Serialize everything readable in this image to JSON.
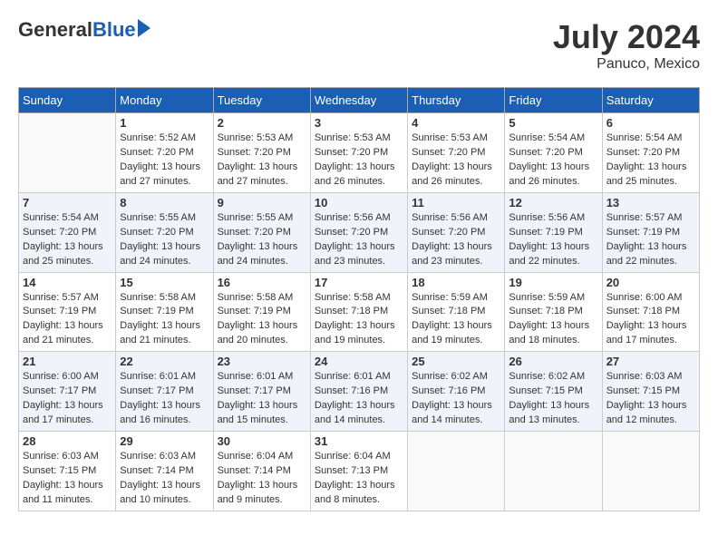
{
  "header": {
    "logo_general": "General",
    "logo_blue": "Blue",
    "month_year": "July 2024",
    "location": "Panuco, Mexico"
  },
  "days_of_week": [
    "Sunday",
    "Monday",
    "Tuesday",
    "Wednesday",
    "Thursday",
    "Friday",
    "Saturday"
  ],
  "weeks": [
    [
      {
        "day": "",
        "info": ""
      },
      {
        "day": "1",
        "info": "Sunrise: 5:52 AM\nSunset: 7:20 PM\nDaylight: 13 hours\nand 27 minutes."
      },
      {
        "day": "2",
        "info": "Sunrise: 5:53 AM\nSunset: 7:20 PM\nDaylight: 13 hours\nand 27 minutes."
      },
      {
        "day": "3",
        "info": "Sunrise: 5:53 AM\nSunset: 7:20 PM\nDaylight: 13 hours\nand 26 minutes."
      },
      {
        "day": "4",
        "info": "Sunrise: 5:53 AM\nSunset: 7:20 PM\nDaylight: 13 hours\nand 26 minutes."
      },
      {
        "day": "5",
        "info": "Sunrise: 5:54 AM\nSunset: 7:20 PM\nDaylight: 13 hours\nand 26 minutes."
      },
      {
        "day": "6",
        "info": "Sunrise: 5:54 AM\nSunset: 7:20 PM\nDaylight: 13 hours\nand 25 minutes."
      }
    ],
    [
      {
        "day": "7",
        "info": "Sunrise: 5:54 AM\nSunset: 7:20 PM\nDaylight: 13 hours\nand 25 minutes."
      },
      {
        "day": "8",
        "info": "Sunrise: 5:55 AM\nSunset: 7:20 PM\nDaylight: 13 hours\nand 24 minutes."
      },
      {
        "day": "9",
        "info": "Sunrise: 5:55 AM\nSunset: 7:20 PM\nDaylight: 13 hours\nand 24 minutes."
      },
      {
        "day": "10",
        "info": "Sunrise: 5:56 AM\nSunset: 7:20 PM\nDaylight: 13 hours\nand 23 minutes."
      },
      {
        "day": "11",
        "info": "Sunrise: 5:56 AM\nSunset: 7:20 PM\nDaylight: 13 hours\nand 23 minutes."
      },
      {
        "day": "12",
        "info": "Sunrise: 5:56 AM\nSunset: 7:19 PM\nDaylight: 13 hours\nand 22 minutes."
      },
      {
        "day": "13",
        "info": "Sunrise: 5:57 AM\nSunset: 7:19 PM\nDaylight: 13 hours\nand 22 minutes."
      }
    ],
    [
      {
        "day": "14",
        "info": "Sunrise: 5:57 AM\nSunset: 7:19 PM\nDaylight: 13 hours\nand 21 minutes."
      },
      {
        "day": "15",
        "info": "Sunrise: 5:58 AM\nSunset: 7:19 PM\nDaylight: 13 hours\nand 21 minutes."
      },
      {
        "day": "16",
        "info": "Sunrise: 5:58 AM\nSunset: 7:19 PM\nDaylight: 13 hours\nand 20 minutes."
      },
      {
        "day": "17",
        "info": "Sunrise: 5:58 AM\nSunset: 7:18 PM\nDaylight: 13 hours\nand 19 minutes."
      },
      {
        "day": "18",
        "info": "Sunrise: 5:59 AM\nSunset: 7:18 PM\nDaylight: 13 hours\nand 19 minutes."
      },
      {
        "day": "19",
        "info": "Sunrise: 5:59 AM\nSunset: 7:18 PM\nDaylight: 13 hours\nand 18 minutes."
      },
      {
        "day": "20",
        "info": "Sunrise: 6:00 AM\nSunset: 7:18 PM\nDaylight: 13 hours\nand 17 minutes."
      }
    ],
    [
      {
        "day": "21",
        "info": "Sunrise: 6:00 AM\nSunset: 7:17 PM\nDaylight: 13 hours\nand 17 minutes."
      },
      {
        "day": "22",
        "info": "Sunrise: 6:01 AM\nSunset: 7:17 PM\nDaylight: 13 hours\nand 16 minutes."
      },
      {
        "day": "23",
        "info": "Sunrise: 6:01 AM\nSunset: 7:17 PM\nDaylight: 13 hours\nand 15 minutes."
      },
      {
        "day": "24",
        "info": "Sunrise: 6:01 AM\nSunset: 7:16 PM\nDaylight: 13 hours\nand 14 minutes."
      },
      {
        "day": "25",
        "info": "Sunrise: 6:02 AM\nSunset: 7:16 PM\nDaylight: 13 hours\nand 14 minutes."
      },
      {
        "day": "26",
        "info": "Sunrise: 6:02 AM\nSunset: 7:15 PM\nDaylight: 13 hours\nand 13 minutes."
      },
      {
        "day": "27",
        "info": "Sunrise: 6:03 AM\nSunset: 7:15 PM\nDaylight: 13 hours\nand 12 minutes."
      }
    ],
    [
      {
        "day": "28",
        "info": "Sunrise: 6:03 AM\nSunset: 7:15 PM\nDaylight: 13 hours\nand 11 minutes."
      },
      {
        "day": "29",
        "info": "Sunrise: 6:03 AM\nSunset: 7:14 PM\nDaylight: 13 hours\nand 10 minutes."
      },
      {
        "day": "30",
        "info": "Sunrise: 6:04 AM\nSunset: 7:14 PM\nDaylight: 13 hours\nand 9 minutes."
      },
      {
        "day": "31",
        "info": "Sunrise: 6:04 AM\nSunset: 7:13 PM\nDaylight: 13 hours\nand 8 minutes."
      },
      {
        "day": "",
        "info": ""
      },
      {
        "day": "",
        "info": ""
      },
      {
        "day": "",
        "info": ""
      }
    ]
  ]
}
